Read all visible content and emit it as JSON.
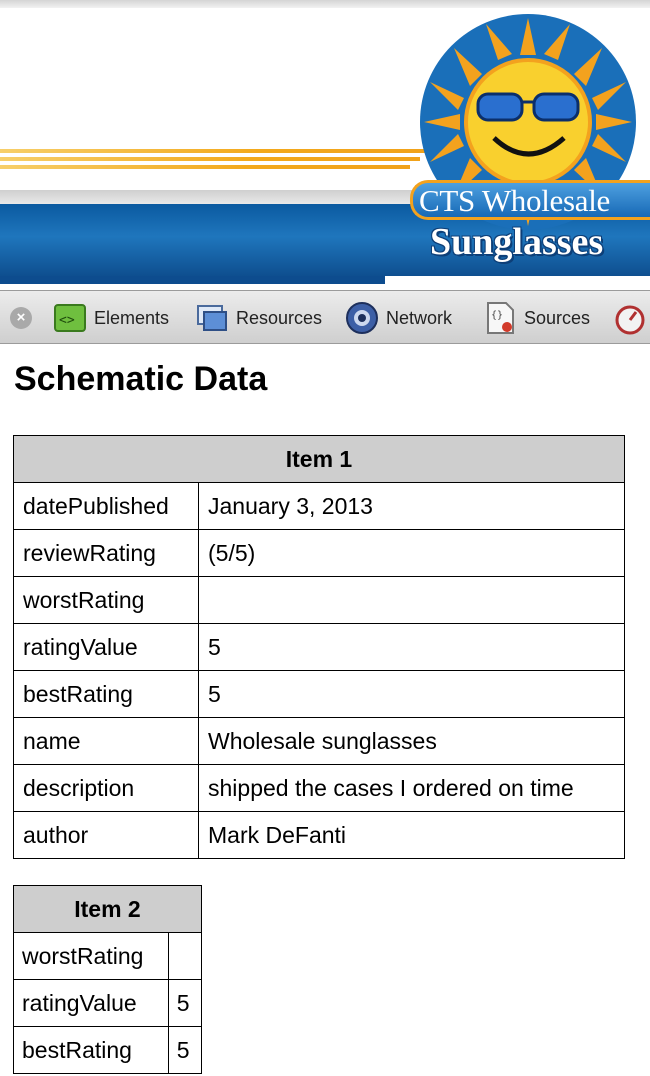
{
  "banner": {
    "logo_line1": "CTS Wholesale",
    "logo_line2": "Sunglasses"
  },
  "devtools": {
    "tabs": [
      {
        "label": "Elements",
        "icon": "elements-icon"
      },
      {
        "label": "Resources",
        "icon": "resources-icon"
      },
      {
        "label": "Network",
        "icon": "network-icon"
      },
      {
        "label": "Sources",
        "icon": "sources-icon"
      }
    ]
  },
  "page": {
    "title": "Schematic Data"
  },
  "items": [
    {
      "header": "Item 1",
      "rows": [
        {
          "key": "datePublished",
          "value": "January 3, 2013"
        },
        {
          "key": "reviewRating",
          "value": "(5/5)"
        },
        {
          "key": "worstRating",
          "value": ""
        },
        {
          "key": "ratingValue",
          "value": "5"
        },
        {
          "key": "bestRating",
          "value": "5"
        },
        {
          "key": "name",
          "value": "Wholesale sunglasses"
        },
        {
          "key": "description",
          "value": "shipped the cases I ordered on time"
        },
        {
          "key": "author",
          "value": "Mark DeFanti"
        }
      ]
    },
    {
      "header": "Item 2",
      "rows": [
        {
          "key": "worstRating",
          "value": ""
        },
        {
          "key": "ratingValue",
          "value": "5"
        },
        {
          "key": "bestRating",
          "value": "5"
        }
      ]
    }
  ],
  "colors": {
    "banner_blue": "#1f76bd",
    "stripe_orange": "#f3a91c",
    "table_header_bg": "#cecece"
  }
}
